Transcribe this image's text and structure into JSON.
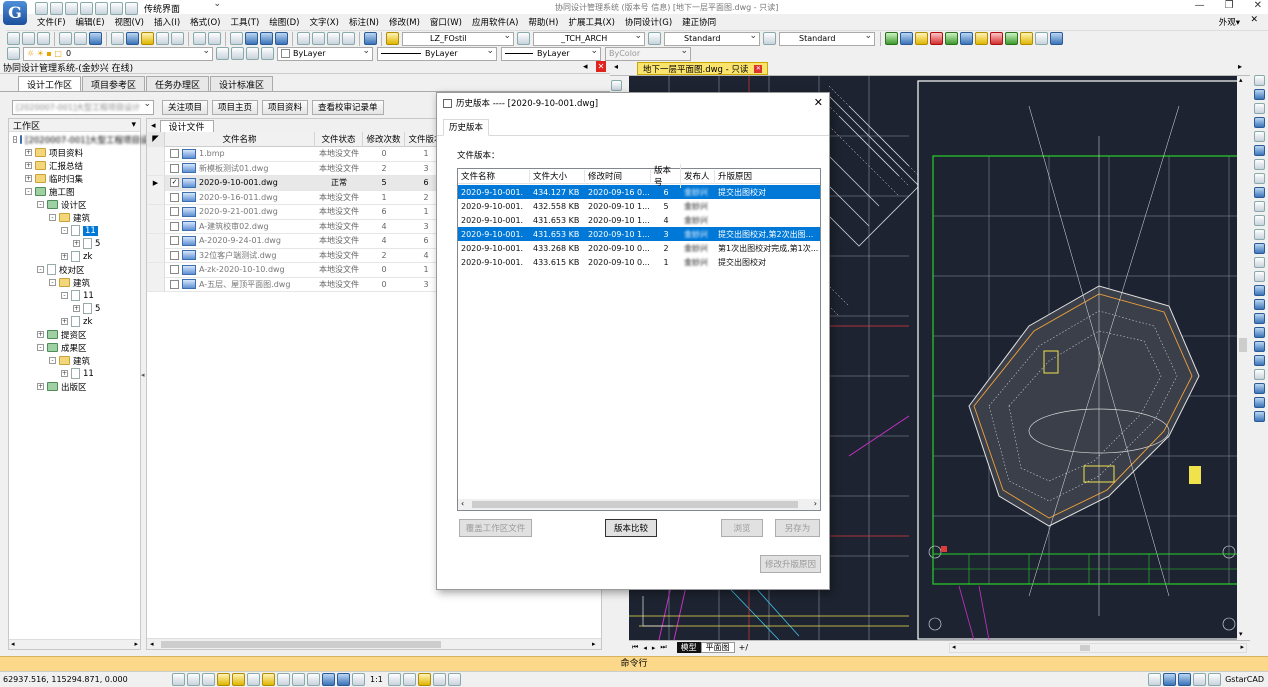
{
  "titlebar": {
    "workspace_name": "传统界面",
    "title_text": "协同设计管理系统 (版本号 信息)  [地下一层平面图.dwg - 只读]"
  },
  "menu": {
    "items": [
      "文件(F)",
      "编辑(E)",
      "视图(V)",
      "插入(I)",
      "格式(O)",
      "工具(T)",
      "绘图(D)",
      "文字(X)",
      "标注(N)",
      "修改(M)",
      "窗口(W)",
      "应用软件(A)",
      "帮助(H)",
      "扩展工具(X)",
      "协同设计(G)",
      "建正协同"
    ],
    "right_label": "外观▾"
  },
  "toolbar2": {
    "textstyle": "LZ_FOstil",
    "font": "_TCH_ARCH",
    "dimstyle": "Standard",
    "tablestyle": "Standard"
  },
  "toolbar3": {
    "layer": "0",
    "color": "ByLayer",
    "linetype": "ByLayer",
    "lineweight": "ByLayer",
    "plotstyle": "ByColor"
  },
  "left_panel": {
    "title": "协同设计管理系统-(金妙兴 在线)",
    "tabs": [
      "设计工作区",
      "项目参考区",
      "任务办理区",
      "设计标准区"
    ],
    "project_combo": "[2020007-001]大型工程项目设计",
    "buttons": [
      "关注项目",
      "项目主页",
      "项目资料",
      "查看校审记录单"
    ],
    "tree_header": "工作区",
    "file_tab": "设计文件"
  },
  "tree": [
    {
      "level": 0,
      "pm": "-",
      "type": "root",
      "label": "[2020007-001]大型工程项目设计"
    },
    {
      "level": 1,
      "pm": "+",
      "type": "folder",
      "label": "项目资料"
    },
    {
      "level": 1,
      "pm": "+",
      "type": "folder",
      "label": "汇报总结"
    },
    {
      "level": 1,
      "pm": "+",
      "type": "folder",
      "label": "临时归集"
    },
    {
      "level": 1,
      "pm": "-",
      "type": "group",
      "label": "施工图"
    },
    {
      "level": 2,
      "pm": "-",
      "type": "group",
      "label": "设计区"
    },
    {
      "level": 3,
      "pm": "-",
      "type": "folder",
      "label": "建筑"
    },
    {
      "level": 4,
      "pm": "-",
      "type": "doc",
      "label": "11",
      "selected": true
    },
    {
      "level": 5,
      "pm": "+",
      "type": "doc",
      "label": "5"
    },
    {
      "level": 4,
      "pm": "+",
      "type": "doc",
      "label": "zk"
    },
    {
      "level": 2,
      "pm": "-",
      "type": "doc",
      "label": "校对区"
    },
    {
      "level": 3,
      "pm": "-",
      "type": "folder",
      "label": "建筑"
    },
    {
      "level": 4,
      "pm": "-",
      "type": "doc",
      "label": "11"
    },
    {
      "level": 5,
      "pm": "+",
      "type": "doc",
      "label": "5"
    },
    {
      "level": 4,
      "pm": "+",
      "type": "doc",
      "label": "zk"
    },
    {
      "level": 2,
      "pm": "+",
      "type": "group",
      "label": "提资区"
    },
    {
      "level": 2,
      "pm": "-",
      "type": "group",
      "label": "成果区"
    },
    {
      "level": 3,
      "pm": "-",
      "type": "folder",
      "label": "建筑"
    },
    {
      "level": 4,
      "pm": "+",
      "type": "doc",
      "label": "11"
    },
    {
      "level": 2,
      "pm": "+",
      "type": "group",
      "label": "出版区"
    }
  ],
  "file_grid": {
    "columns": [
      "文件名称",
      "文件状态",
      "修改次数",
      "文件版本"
    ],
    "rows": [
      {
        "name": "1.bmp",
        "status": "本地没文件",
        "mods": "0",
        "ver": "1",
        "checked": false,
        "current": false
      },
      {
        "name": "新模板测试01.dwg",
        "status": "本地没文件",
        "mods": "2",
        "ver": "3",
        "checked": false,
        "current": false
      },
      {
        "name": "2020-9-10-001.dwg",
        "status": "正常",
        "mods": "5",
        "ver": "6",
        "checked": true,
        "current": true
      },
      {
        "name": "2020-9-16-011.dwg",
        "status": "本地没文件",
        "mods": "1",
        "ver": "2",
        "checked": false,
        "current": false
      },
      {
        "name": "2020-9-21-001.dwg",
        "status": "本地没文件",
        "mods": "6",
        "ver": "1",
        "checked": false,
        "current": false
      },
      {
        "name": "A-建筑校审02.dwg",
        "status": "本地没文件",
        "mods": "4",
        "ver": "3",
        "checked": false,
        "current": false
      },
      {
        "name": "A-2020-9-24-01.dwg",
        "status": "本地没文件",
        "mods": "4",
        "ver": "6",
        "checked": false,
        "current": false
      },
      {
        "name": "32位客户端测试.dwg",
        "status": "本地没文件",
        "mods": "2",
        "ver": "4",
        "checked": false,
        "current": false
      },
      {
        "name": "A-zk-2020-10-10.dwg",
        "status": "本地没文件",
        "mods": "0",
        "ver": "1",
        "checked": false,
        "current": false
      },
      {
        "name": "A-五层、屋顶平面图.dwg",
        "status": "本地没文件",
        "mods": "0",
        "ver": "3",
        "checked": false,
        "current": false
      }
    ]
  },
  "drawing": {
    "tab_label": "地下一层平面图.dwg - 只读",
    "layout_tabs": [
      "模型",
      "平面图"
    ]
  },
  "dialog": {
    "title": "历史版本 ---- [2020-9-10-001.dwg]",
    "tab": "历史版本",
    "section_label": "文件版本：",
    "columns": [
      "文件名称",
      "文件大小",
      "修改时间",
      "版本号",
      "发布人",
      "升版原因"
    ],
    "rows": [
      {
        "name": "2020-9-10-001.",
        "size": "434.127 KB",
        "time": "2020-09-16 0...",
        "ver": "6",
        "pub": "金妙兴",
        "reason": "提交出图校对",
        "selected": true
      },
      {
        "name": "2020-9-10-001.",
        "size": "432.558 KB",
        "time": "2020-09-10 1...",
        "ver": "5",
        "pub": "金妙兴",
        "reason": "",
        "selected": false
      },
      {
        "name": "2020-9-10-001.",
        "size": "431.653 KB",
        "time": "2020-09-10 1...",
        "ver": "4",
        "pub": "金妙兴",
        "reason": "",
        "selected": false
      },
      {
        "name": "2020-9-10-001.",
        "size": "431.653 KB",
        "time": "2020-09-10 1...",
        "ver": "3",
        "pub": "金妙兴",
        "reason": "提交出图校对,第2次出图...",
        "selected": true
      },
      {
        "name": "2020-9-10-001.",
        "size": "433.268 KB",
        "time": "2020-09-10 0...",
        "ver": "2",
        "pub": "金妙兴",
        "reason": "第1次出图校对完成,第1次...",
        "selected": false
      },
      {
        "name": "2020-9-10-001.",
        "size": "433.615 KB",
        "time": "2020-09-10 0...",
        "ver": "1",
        "pub": "金妙兴",
        "reason": "提交出图校对",
        "selected": false
      }
    ],
    "buttons": {
      "replace": "覆盖工作区文件",
      "compare": "版本比较",
      "view": "浏览",
      "save_as": "另存为",
      "modify_reason": "修改升版原因"
    }
  },
  "command_line": "命令行",
  "status": {
    "coords": "62937.516, 115294.871, 0.000",
    "scale": "1:1",
    "brand": "GstarCAD"
  }
}
